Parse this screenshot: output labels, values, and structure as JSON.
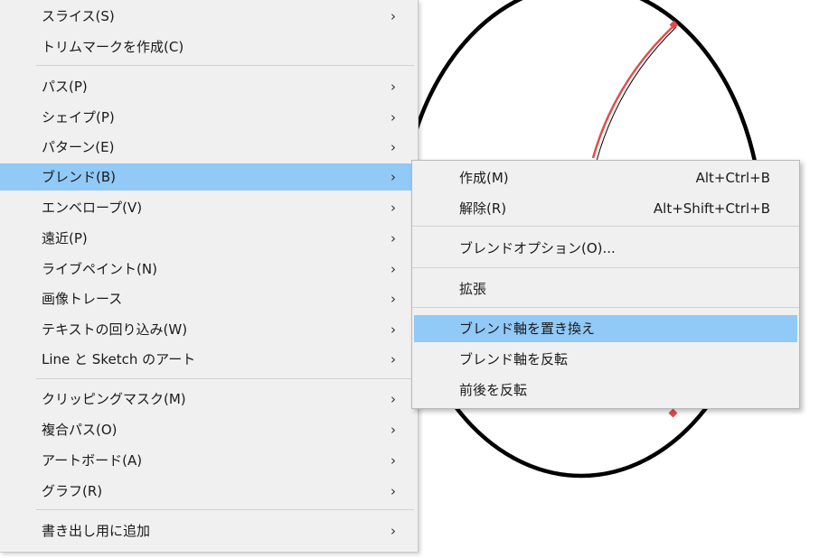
{
  "main_menu": {
    "items": [
      {
        "label": "スライス(S)",
        "arrow": "›"
      },
      {
        "label": "トリムマークを作成(C)",
        "arrow": ""
      },
      {
        "label": "パス(P)",
        "arrow": "›"
      },
      {
        "label": "シェイプ(P)",
        "arrow": "›"
      },
      {
        "label": "パターン(E)",
        "arrow": "›"
      },
      {
        "label": "ブレンド(B)",
        "arrow": "›"
      },
      {
        "label": "エンベロープ(V)",
        "arrow": "›"
      },
      {
        "label": "遠近(P)",
        "arrow": "›"
      },
      {
        "label": "ライブペイント(N)",
        "arrow": "›"
      },
      {
        "label": "画像トレース",
        "arrow": "›"
      },
      {
        "label": "テキストの回り込み(W)",
        "arrow": "›"
      },
      {
        "label": "Line と Sketch のアート",
        "arrow": "›"
      },
      {
        "label": "クリッピングマスク(M)",
        "arrow": "›"
      },
      {
        "label": "複合パス(O)",
        "arrow": "›"
      },
      {
        "label": "アートボード(A)",
        "arrow": "›"
      },
      {
        "label": "グラフ(R)",
        "arrow": "›"
      },
      {
        "label": "書き出し用に追加",
        "arrow": "›"
      }
    ]
  },
  "blend_submenu": {
    "items": [
      {
        "label": "作成(M)",
        "shortcut": "Alt+Ctrl+B"
      },
      {
        "label": "解除(R)",
        "shortcut": "Alt+Shift+Ctrl+B"
      },
      {
        "label": "ブレンドオプション(O)...",
        "shortcut": ""
      },
      {
        "label": "拡張",
        "shortcut": ""
      },
      {
        "label": "ブレンド軸を置き換え",
        "shortcut": ""
      },
      {
        "label": "ブレンド軸を反転",
        "shortcut": ""
      },
      {
        "label": "前後を反転",
        "shortcut": ""
      }
    ]
  },
  "colors": {
    "highlight": "#91c9f7",
    "menu_bg": "#f0f0f0",
    "artwork_stroke": "#000000",
    "blend_path": "#e34b4b"
  }
}
